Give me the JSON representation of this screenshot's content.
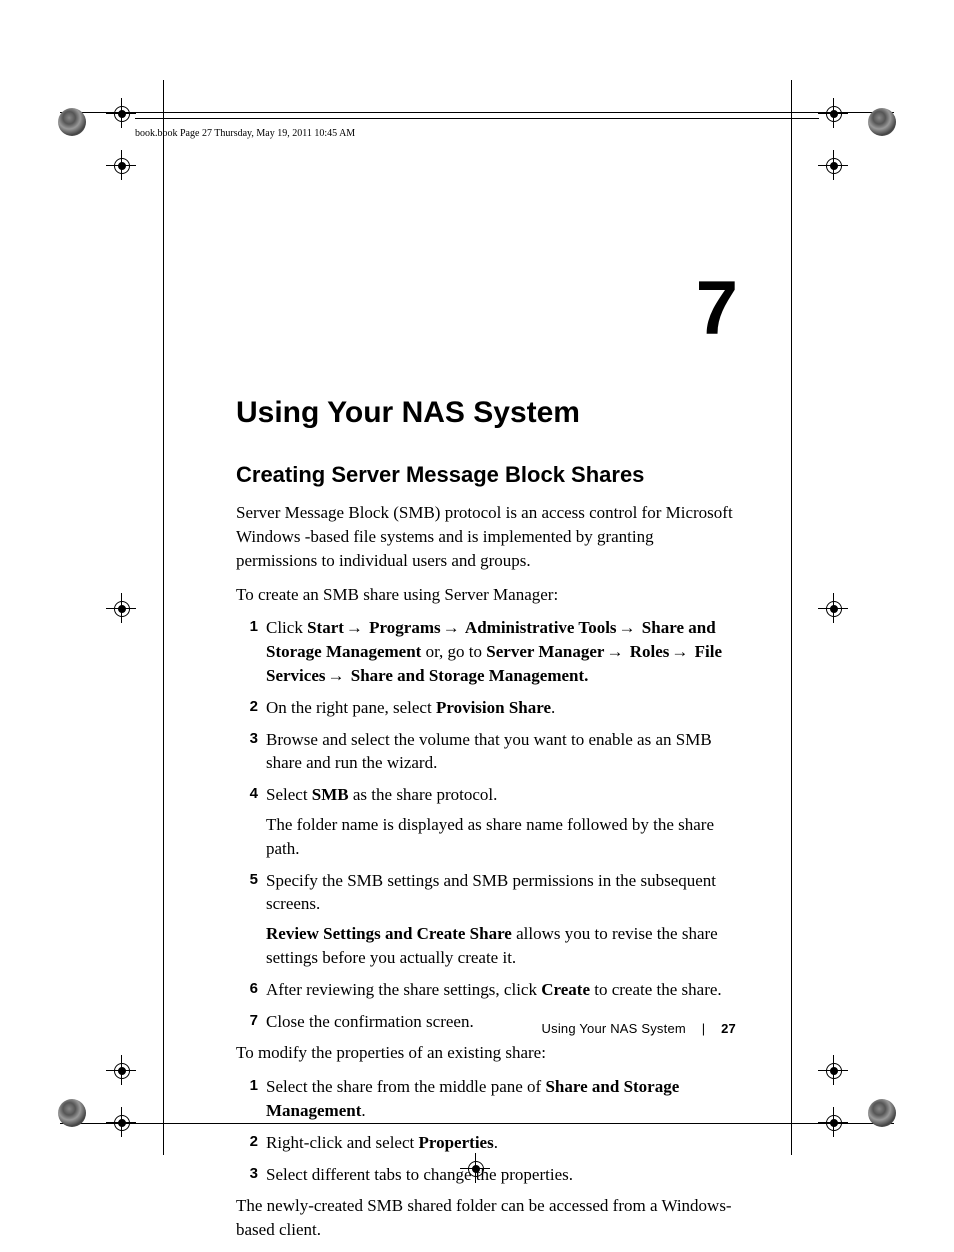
{
  "header": {
    "runner": "book.book  Page 27  Thursday, May 19, 2011  10:45 AM"
  },
  "chapter": {
    "number": "7",
    "title": "Using Your NAS System"
  },
  "section": {
    "title": "Creating Server Message Block Shares"
  },
  "intro": {
    "p1": "Server Message Block (SMB) protocol is an access control for Microsoft Windows -based file systems and is implemented by granting permissions to individual users and groups.",
    "p2": "To create an SMB share using Server Manager:"
  },
  "stepsA": {
    "s1": {
      "n": "1",
      "pre": "Click ",
      "b1": "Start",
      "a1": "→",
      "b2": " Programs",
      "a2": "→",
      "b3": " Administrative Tools",
      "a3": "→",
      "b4": " Share and Storage Management",
      "mid": " or, go to ",
      "b5": "Server Manager",
      "a4": "→",
      "b6": " Roles",
      "a5": "→",
      "b7": " File Services",
      "a6": "→",
      "b8": " Share and Storage Management."
    },
    "s2": {
      "n": "2",
      "pre": "On the right pane, select ",
      "b1": "Provision Share",
      "post": "."
    },
    "s3": {
      "n": "3",
      "txt": "Browse and select the volume that you want to enable as an SMB share and run the wizard."
    },
    "s4": {
      "n": "4",
      "pre": "Select ",
      "b1": "SMB",
      "post": " as the share protocol.",
      "sub": "The folder name is displayed as share name followed by the share path."
    },
    "s5": {
      "n": "5",
      "txt": "Specify the SMB settings and SMB permissions in the subsequent screens.",
      "sub_b": "Review Settings and Create Share",
      "sub_post": " allows you to revise the share settings before you actually create it."
    },
    "s6": {
      "n": "6",
      "pre": "After reviewing the share settings, click ",
      "b1": "Create",
      "post": " to create the share."
    },
    "s7": {
      "n": "7",
      "txt": "Close the confirmation screen."
    }
  },
  "mid_p": "To modify the properties of an existing share:",
  "stepsB": {
    "s1": {
      "n": "1",
      "pre": "Select the share from the middle pane of ",
      "b1": "Share and Storage Management",
      "post": "."
    },
    "s2": {
      "n": "2",
      "pre": "Right-click and select ",
      "b1": "Properties",
      "post": "."
    },
    "s3": {
      "n": "3",
      "txt": "Select different tabs to change the properties."
    }
  },
  "outro": "The newly-created SMB shared folder can be accessed from a Windows-based client.",
  "footer": {
    "section": "Using Your NAS System",
    "sep": "|",
    "page": "27"
  }
}
